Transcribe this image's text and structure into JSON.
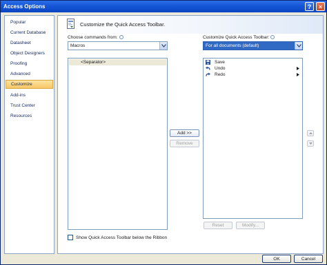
{
  "window": {
    "title": "Access Options"
  },
  "titlebar_buttons": {
    "help": "?",
    "close": "×"
  },
  "sidebar": {
    "items": [
      {
        "label": "Popular"
      },
      {
        "label": "Current Database"
      },
      {
        "label": "Datasheet"
      },
      {
        "label": "Object Designers"
      },
      {
        "label": "Proofing"
      },
      {
        "label": "Advanced"
      },
      {
        "label": "Customize",
        "selected": true
      },
      {
        "label": "Add-ins"
      },
      {
        "label": "Trust Center"
      },
      {
        "label": "Resources"
      }
    ]
  },
  "header": {
    "text": "Customize the Quick Access Toolbar."
  },
  "left_panel": {
    "label": "Choose commands from:",
    "combo_value": "Macros",
    "items": [
      {
        "label": "<Separator>"
      }
    ]
  },
  "right_panel": {
    "label": "Customize Quick Access Toolbar:",
    "combo_value": "For all documents (default)",
    "items": [
      {
        "label": "Save",
        "icon": "floppy-disk-icon",
        "has_arrow": false
      },
      {
        "label": "Undo",
        "icon": "undo-arrow-icon",
        "has_arrow": true
      },
      {
        "label": "Redo",
        "icon": "redo-arrow-icon",
        "has_arrow": true
      }
    ]
  },
  "buttons": {
    "add": "Add >>",
    "remove": "Remove",
    "reset": "Reset",
    "modify": "Modify..."
  },
  "checkbox": {
    "label": "Show Quick Access Toolbar below the Ribbon",
    "checked": false
  },
  "footer": {
    "ok": "OK",
    "cancel": "Cancel"
  },
  "colors": {
    "titlebar": "#1556d6",
    "selection_blue": "#316ac5",
    "nav_selected": "#f7c667",
    "dialog_bg": "#ece9d8"
  }
}
